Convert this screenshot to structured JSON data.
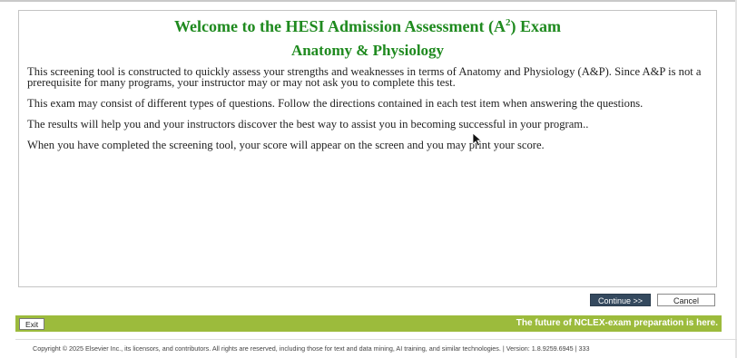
{
  "header": {
    "title_prefix": "Welcome to the HESI Admission Assessment (A",
    "title_superscript": "2",
    "title_suffix": ") Exam",
    "subtitle": "Anatomy & Physiology",
    "title_color": "#1f8a1f"
  },
  "content": {
    "paragraphs": [
      "This screening tool is constructed to quickly assess your strengths and weaknesses in terms of Anatomy and Physiology (A&P).  Since A&P is not a prerequisite for many programs, your instructor may or may not ask you to complete this test.",
      "This exam may consist of different types of questions.  Follow the directions contained in each test item when answering the questions.",
      "The results will help you and your instructors discover the best way to assist you in becoming successful in your program..",
      "When you have completed the screening tool, your score will appear on the screen and you may print your score."
    ]
  },
  "actions": {
    "continue_label": "Continue >>",
    "cancel_label": "Cancel",
    "continue_color": "#34495e"
  },
  "bottom_bar": {
    "exit_label": "Exit",
    "tagline": "The future of NCLEX-exam preparation is here.",
    "bar_color": "#9cbb3c"
  },
  "footer": {
    "copyright": "Copyright © 2025 Elsevier Inc., its licensors, and contributors. All rights are reserved, including those for text and data mining, AI training, and similar technologies.",
    "version": "| Version: 1.8.9259.6945 | 333"
  },
  "icons": {
    "cursor": "mouse-pointer-icon"
  }
}
